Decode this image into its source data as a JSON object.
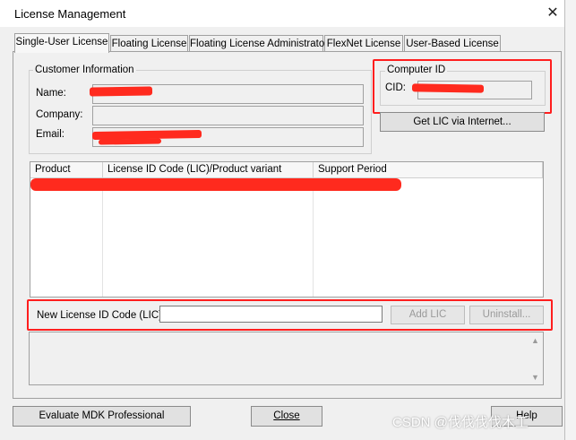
{
  "window": {
    "title": "License Management",
    "close_label": "✕"
  },
  "tabs": [
    {
      "label": "Single-User License",
      "active": true
    },
    {
      "label": "Floating License",
      "active": false
    },
    {
      "label": "Floating License Administrator",
      "active": false
    },
    {
      "label": "FlexNet License",
      "active": false
    },
    {
      "label": "User-Based License",
      "active": false
    }
  ],
  "customer_info": {
    "group_label": "Customer Information",
    "name_label": "Name:",
    "company_label": "Company:",
    "email_label": "Email:"
  },
  "computer_id": {
    "group_label": "Computer ID",
    "cid_label": "CID:"
  },
  "get_lic_button": "Get LIC via Internet...",
  "table": {
    "columns": [
      "Product",
      "License ID Code (LIC)/Product variant",
      "Support Period"
    ]
  },
  "new_lic": {
    "label": "New License ID Code (LIC):",
    "value": "",
    "add_button": "Add LIC",
    "uninstall_button": "Uninstall..."
  },
  "bottom": {
    "evaluate_button": "Evaluate MDK Professional",
    "close_button": "Close",
    "help_button": "Help"
  },
  "watermark": "CSDN @伐伐伐伐木工",
  "colors": {
    "redaction": "#ff2a1e",
    "highlight_outline": "#ff1e1e"
  }
}
